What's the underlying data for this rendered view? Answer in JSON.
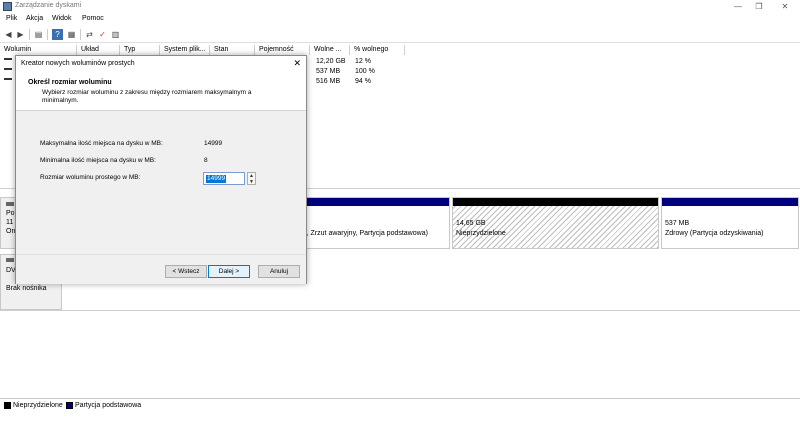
{
  "window": {
    "title": "Zarządzanie dyskami",
    "controls": [
      "—",
      "❐",
      "✕"
    ]
  },
  "menu": [
    "Plik",
    "Akcja",
    "Widok",
    "Pomoc"
  ],
  "toolbar": [
    "◀",
    "▶",
    "▤",
    "?",
    "▦",
    "⇄",
    "✓",
    "▥"
  ],
  "columns": [
    "Wolumin",
    "Układ",
    "Typ",
    "System plik...",
    "Stan",
    "Pojemność",
    "Wolne ...",
    "% wolnego"
  ],
  "volumes": [
    {
      "free": "12,20 GB",
      "pct": "12 %"
    },
    {
      "free": "537 MB",
      "pct": "100 %"
    },
    {
      "free": "516 MB",
      "pct": "94 %"
    }
  ],
  "disks": {
    "disk0_label": [
      "Po",
      "11",
      "On"
    ],
    "partition_a_text": "rust, Zrzut awaryjny, Partycja podstawowa)",
    "partition_b_size": "14,65 GB",
    "partition_b_status": "Nieprzydzielone",
    "partition_c_size": "537 MB",
    "partition_c_status": "Zdrowy (Partycja odzyskiwania)",
    "dvd_label": "DV",
    "dvd_status": "Brak nośnika"
  },
  "legend": [
    {
      "label": "Nieprzydzielone",
      "color": "#000000"
    },
    {
      "label": "Partycja podstawowa",
      "color": "#00007f"
    }
  ],
  "dialog": {
    "title": "Kreator nowych woluminów prostych",
    "close": "✕",
    "heading": "Określ rozmiar woluminu",
    "subheading": "Wybierz rozmiar woluminu z zakresu między rozmiarem maksymalnym a minimalnym.",
    "max_label": "Maksymalna ilość miejsca na dysku w MB:",
    "max_value": "14999",
    "min_label": "Minimalna ilość miejsca na dysku w MB:",
    "min_value": "8",
    "size_label": "Rozmiar woluminu prostego w MB:",
    "size_value": "14999",
    "back_button": "< Wstecz",
    "next_button": "Dalej >",
    "cancel_button": "Anuluj"
  }
}
